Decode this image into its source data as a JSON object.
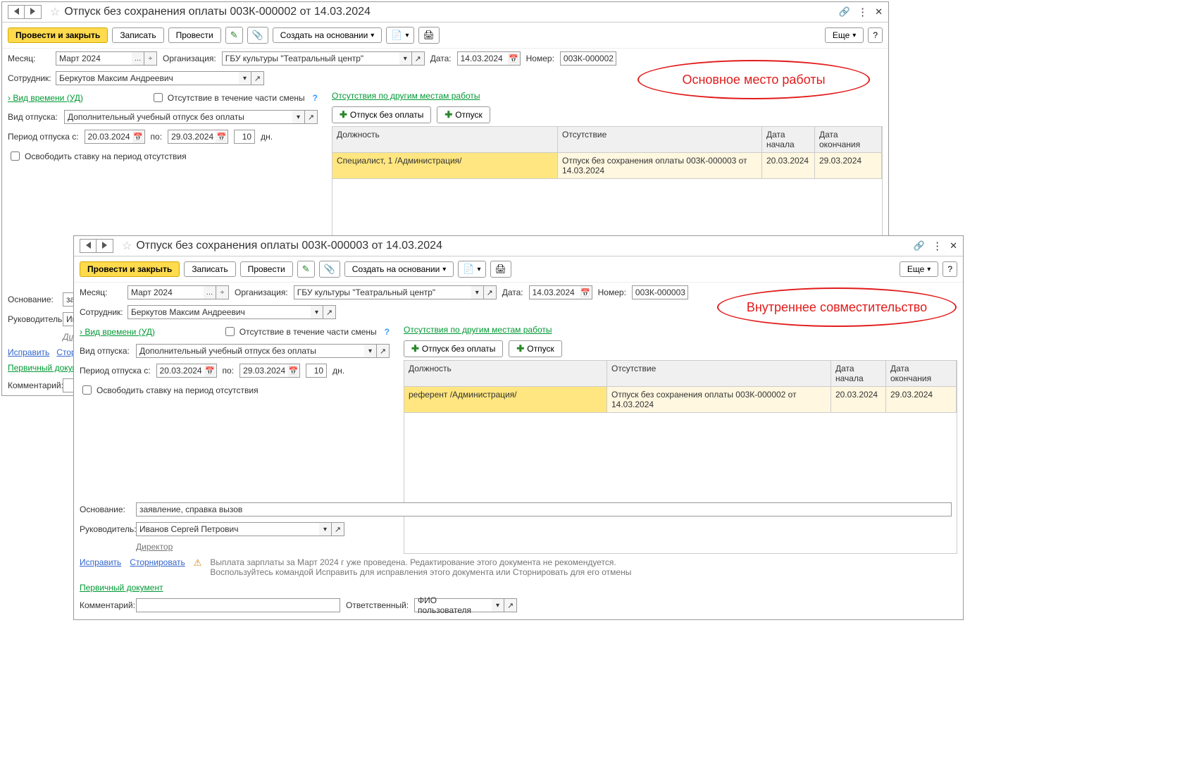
{
  "annot": {
    "main": "Основное место работы",
    "sec": "Внутреннее совместительство"
  },
  "w1": {
    "title": "Отпуск без сохранения оплаты 003К-000002 от 14.03.2024",
    "btns": {
      "post_close": "Провести и закрыть",
      "save": "Записать",
      "post": "Провести",
      "create_based": "Создать на основании",
      "more": "Еще"
    },
    "labels": {
      "month": "Месяц:",
      "org": "Организация:",
      "date": "Дата:",
      "num": "Номер:",
      "emp": "Сотрудник:",
      "time_kind": "Вид времени (УД)",
      "part_shift": "Отсутствие в течение части смены",
      "leave_type": "Вид отпуска:",
      "period_from": "Период отпуска с:",
      "period_to": "по:",
      "days_u": "дн.",
      "free_rate": "Освободить ставку на период отсутствия",
      "abs_other": "Отсутствия по другим местам работы",
      "btn_unpaid": "Отпуск без оплаты",
      "btn_leave": "Отпуск",
      "basis": "Основание:",
      "manager": "Руководитель:",
      "director": "Директор",
      "fix": "Исправить",
      "storno": "Сторнировать",
      "primary_doc": "Первичный документ",
      "comment": "Комментарий:",
      "col_pos": "Должность",
      "col_abs": "Отсутствие",
      "col_ds": "Дата начала",
      "col_de": "Дата окончания"
    },
    "vals": {
      "month": "Март 2024",
      "org": "ГБУ культуры \"Театральный центр\"",
      "date": "14.03.2024",
      "num": "003К-000002",
      "emp": "Беркутов Максим Андреевич",
      "leave_type": "Дополнительный учебный отпуск без оплаты",
      "date_from": "20.03.2024",
      "date_to": "29.03.2024",
      "days": "10",
      "basis": "заявле",
      "manager": "Иван"
    },
    "row": {
      "pos": "Специалист, 1 /Администрация/",
      "abs": "Отпуск без сохранения оплаты 003К-000003 от 14.03.2024",
      "ds": "20.03.2024",
      "de": "29.03.2024"
    }
  },
  "w2": {
    "title": "Отпуск без сохранения оплаты 003К-000003 от 14.03.2024",
    "vals": {
      "month": "Март 2024",
      "org": "ГБУ культуры \"Театральный центр\"",
      "date": "14.03.2024",
      "num": "003К-000003",
      "emp": "Беркутов Максим Андреевич",
      "leave_type": "Дополнительный учебный отпуск без оплаты",
      "date_from": "20.03.2024",
      "date_to": "29.03.2024",
      "days": "10",
      "basis": "заявление, справка вызов",
      "manager": "Иванов Сергей Петрович",
      "resp_label": "Ответственный:",
      "resp": "ФИО пользователя"
    },
    "row": {
      "pos": "референт /Администрация/",
      "abs": "Отпуск без сохранения оплаты 003К-000002 от 14.03.2024",
      "ds": "20.03.2024",
      "de": "29.03.2024"
    },
    "warn": {
      "l1": "Выплата зарплаты за Март 2024 г уже проведена. Редактирование этого документа не рекомендуется.",
      "l2": "Воспользуйтесь командой Исправить для исправления этого документа или Сторнировать для его отмены"
    }
  }
}
